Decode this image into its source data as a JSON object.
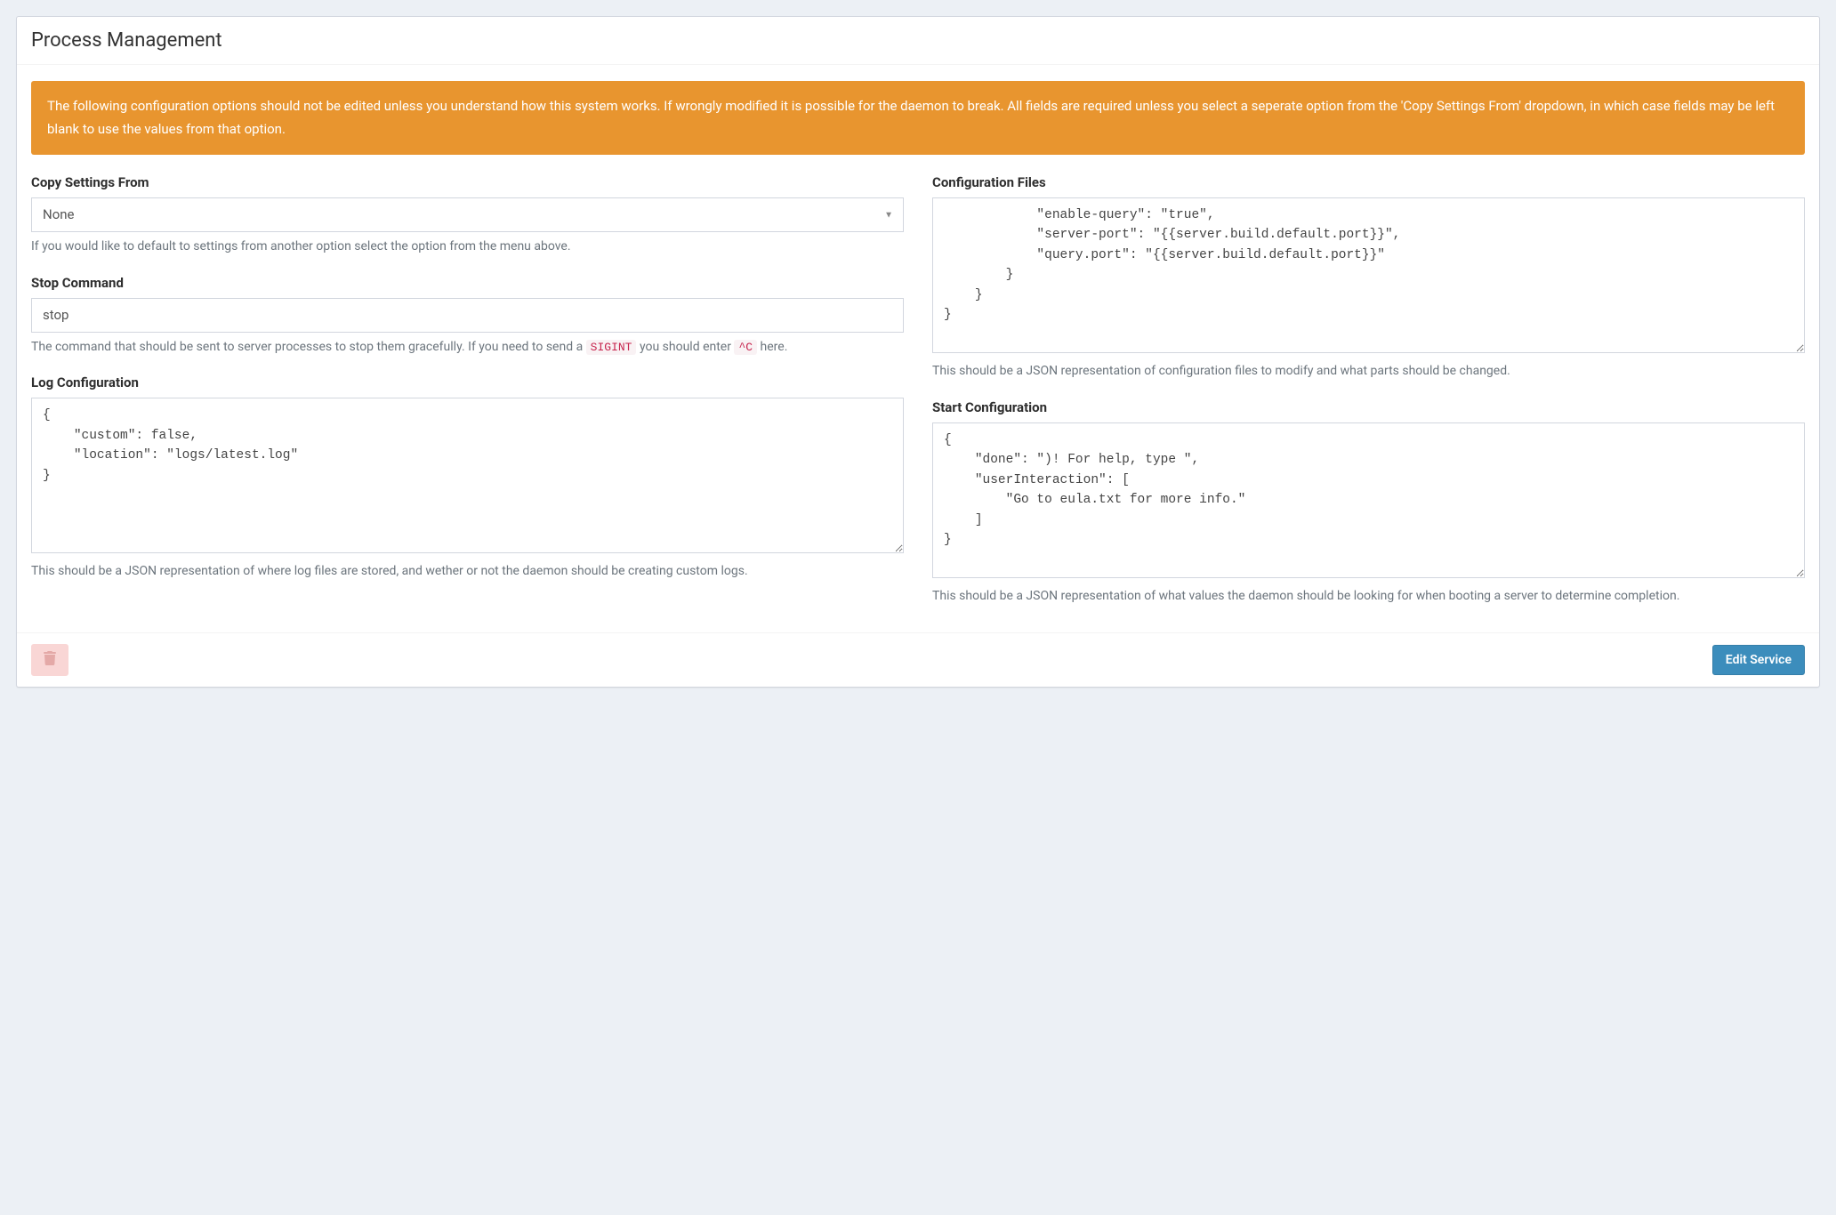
{
  "header": {
    "title": "Process Management"
  },
  "alert": {
    "text": "The following configuration options should not be edited unless you understand how this system works. If wrongly modified it is possible for the daemon to break. All fields are required unless you select a seperate option from the 'Copy Settings From' dropdown, in which case fields may be left blank to use the values from that option."
  },
  "left": {
    "copy_settings": {
      "label": "Copy Settings From",
      "selected": "None",
      "help": "If you would like to default to settings from another option select the option from the menu above."
    },
    "stop_command": {
      "label": "Stop Command",
      "value": "stop",
      "help_prefix": "The command that should be sent to server processes to stop them gracefully. If you need to send a ",
      "sigint": "SIGINT",
      "help_middle": " you should enter ",
      "ctrlc": "^C",
      "help_suffix": " here."
    },
    "log_config": {
      "label": "Log Configuration",
      "value": "{\n    \"custom\": false,\n    \"location\": \"logs/latest.log\"\n}",
      "help": "This should be a JSON representation of where log files are stored, and wether or not the daemon should be creating custom logs."
    }
  },
  "right": {
    "config_files": {
      "label": "Configuration Files",
      "value": "            \"enable-query\": \"true\",\n            \"server-port\": \"{{server.build.default.port}}\",\n            \"query.port\": \"{{server.build.default.port}}\"\n        }\n    }\n}",
      "help": "This should be a JSON representation of configuration files to modify and what parts should be changed."
    },
    "start_config": {
      "label": "Start Configuration",
      "value": "{\n    \"done\": \")! For help, type \",\n    \"userInteraction\": [\n        \"Go to eula.txt for more info.\"\n    ]\n}",
      "help": "This should be a JSON representation of what values the daemon should be looking for when booting a server to determine completion."
    }
  },
  "footer": {
    "edit_service": "Edit Service"
  }
}
